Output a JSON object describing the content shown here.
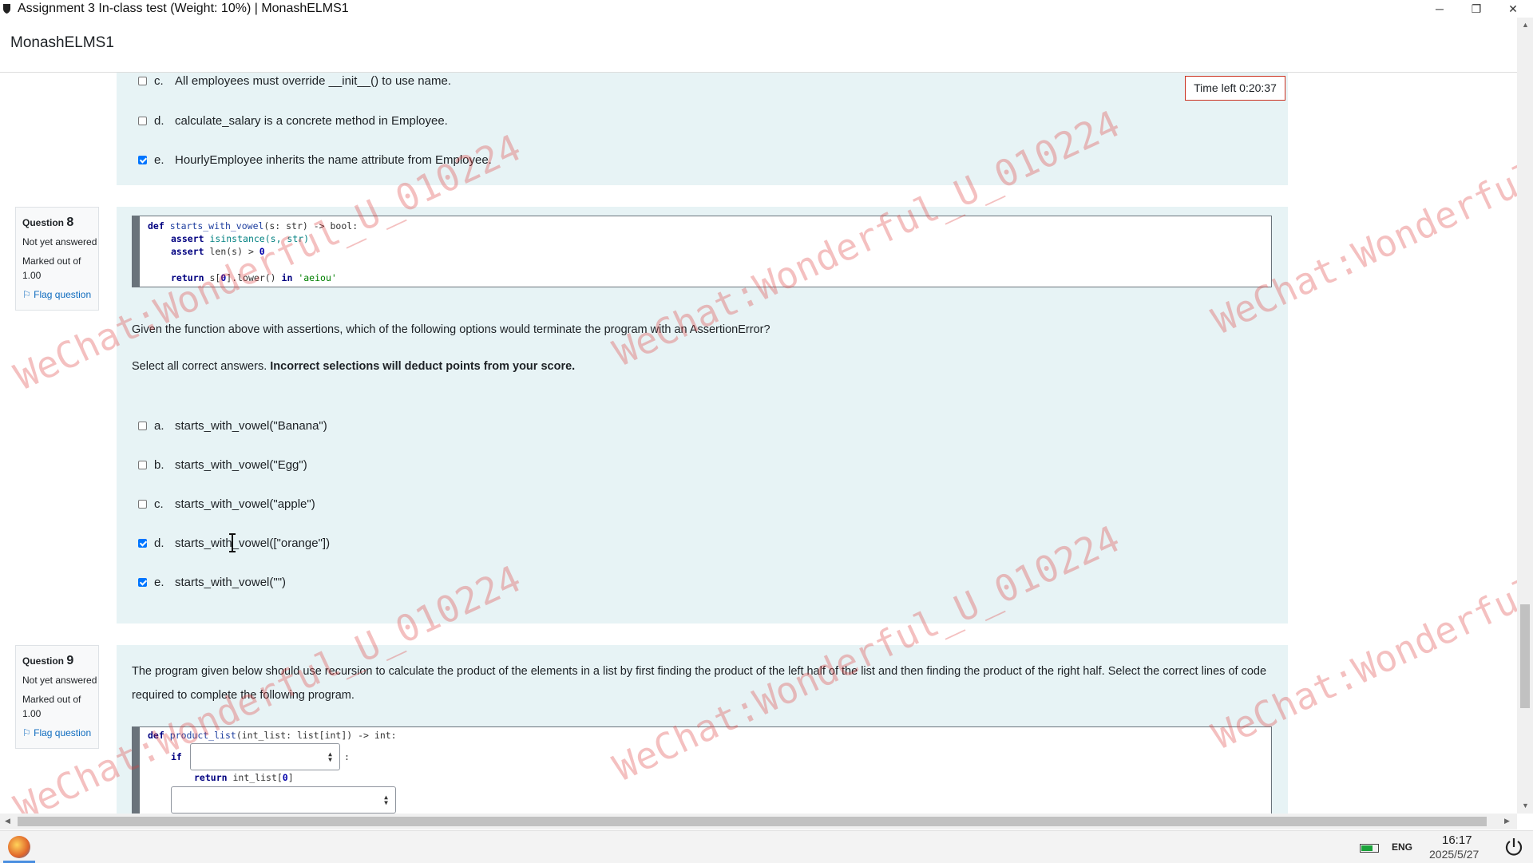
{
  "window": {
    "title": "Assignment 3 In-class test (Weight: 10%) | MonashELMS1",
    "minimize_glyph": "─",
    "restore_glyph": "❐",
    "close_glyph": "✕"
  },
  "app": {
    "brand": "MonashELMS1"
  },
  "timer": {
    "text": "Time left 0:20:37"
  },
  "question7_tail": {
    "options": [
      {
        "letter": "c.",
        "text": "All employees must override __init__() to use name.",
        "checked": false
      },
      {
        "letter": "d.",
        "text": "calculate_salary is a concrete method in Employee.",
        "checked": false
      },
      {
        "letter": "e.",
        "text": "HourlyEmployee inherits the name attribute from Employee.",
        "checked": true
      }
    ]
  },
  "question8": {
    "label": "Question",
    "number": "8",
    "status": "Not yet answered",
    "marked": "Marked out of 1.00",
    "flag": "Flag question",
    "code": {
      "l1_def": "def",
      "l1_name": "starts_with_vowel",
      "l1_rest": "(s: str) -> bool:",
      "l2": "assert",
      "l2_rest": "isinstance(s, str)",
      "l3": "assert",
      "l3_rest": "len(s) > ",
      "l3_num": "0",
      "l4_ret": "return",
      "l4_a": "s[",
      "l4_num": "0",
      "l4_b": "].lower()",
      "l4_in": "in",
      "l4_str": "'aeiou'"
    },
    "prompt": "Given the function above with assertions, which of the following options would terminate the program with an AssertionError?",
    "instruction_plain": "Select all correct answers. ",
    "instruction_bold": "Incorrect selections will deduct points from your score.",
    "options": [
      {
        "letter": "a.",
        "text": "starts_with_vowel(\"Banana\")",
        "checked": false
      },
      {
        "letter": "b.",
        "text": "starts_with_vowel(\"Egg\")",
        "checked": false
      },
      {
        "letter": "c.",
        "text": "starts_with_vowel(\"apple\")",
        "checked": false
      },
      {
        "letter": "d.",
        "text": "starts_with_vowel([\"orange\"])",
        "checked": true
      },
      {
        "letter": "e.",
        "text": "starts_with_vowel(\"\")",
        "checked": true
      }
    ]
  },
  "question9": {
    "label": "Question",
    "number": "9",
    "status": "Not yet answered",
    "marked": "Marked out of 1.00",
    "flag": "Flag question",
    "prompt": "The program given below should use recursion to calculate the product of the elements in a list by first finding the product of the left half of the list and then finding the product of the right half. Select the correct lines of code required to complete the following program.",
    "code": {
      "l1_def": "def",
      "l1_name": "product_list",
      "l1_rest": "(int_list: list[int]) -> int:",
      "l2_if": "if",
      "l2_colon": ":",
      "l3_ret": "return",
      "l3_rest": "int_list[",
      "l3_num": "0",
      "l3_end": "]"
    }
  },
  "watermark": "WeChat:Wonderful_U_010224",
  "taskbar": {
    "lang": "ENG",
    "time": "16:17",
    "date": "2025/5/27"
  }
}
